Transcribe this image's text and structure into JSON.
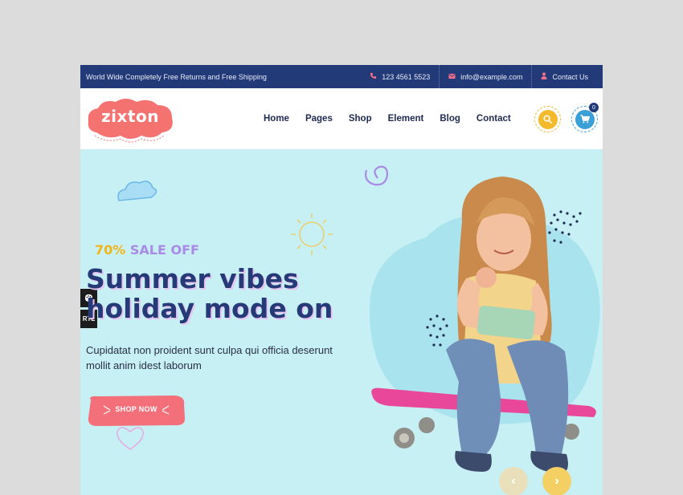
{
  "topbar": {
    "promo": "World Wide Completely Free Returns and Free Shipping",
    "phone": "123 4561 5523",
    "email": "info@example.com",
    "contact": "Contact Us"
  },
  "logo": {
    "text": "zixton"
  },
  "nav": {
    "items": [
      {
        "label": "Home"
      },
      {
        "label": "Pages"
      },
      {
        "label": "Shop"
      },
      {
        "label": "Element"
      },
      {
        "label": "Blog"
      },
      {
        "label": "Contact"
      }
    ]
  },
  "header": {
    "cart_count": "0"
  },
  "sidebar": {
    "rtl_label": "RTL"
  },
  "hero": {
    "sale_percent": "70%",
    "sale_text": "SALE OFF",
    "headline_line1": "Summer vibes",
    "headline_line2": "holiday mode on",
    "description": "Cupidatat non proident sunt culpa qui officia deserunt mollit anim idest laborum",
    "cta_label": "SHOP NOW"
  },
  "colors": {
    "topbar_bg": "#233a78",
    "hero_bg": "#c6f0f3",
    "accent_pink": "#f36f8a",
    "accent_yellow": "#f5b92c",
    "accent_blue": "#3aa0d6",
    "headline": "#263a78",
    "sale_purple": "#a98ae6"
  },
  "icons": {
    "phone": "phone-icon",
    "email": "envelope-icon",
    "user": "user-icon",
    "search": "search-icon",
    "cart": "cart-icon",
    "palette": "palette-icon",
    "prev": "chevron-left-icon",
    "next": "chevron-right-icon"
  }
}
